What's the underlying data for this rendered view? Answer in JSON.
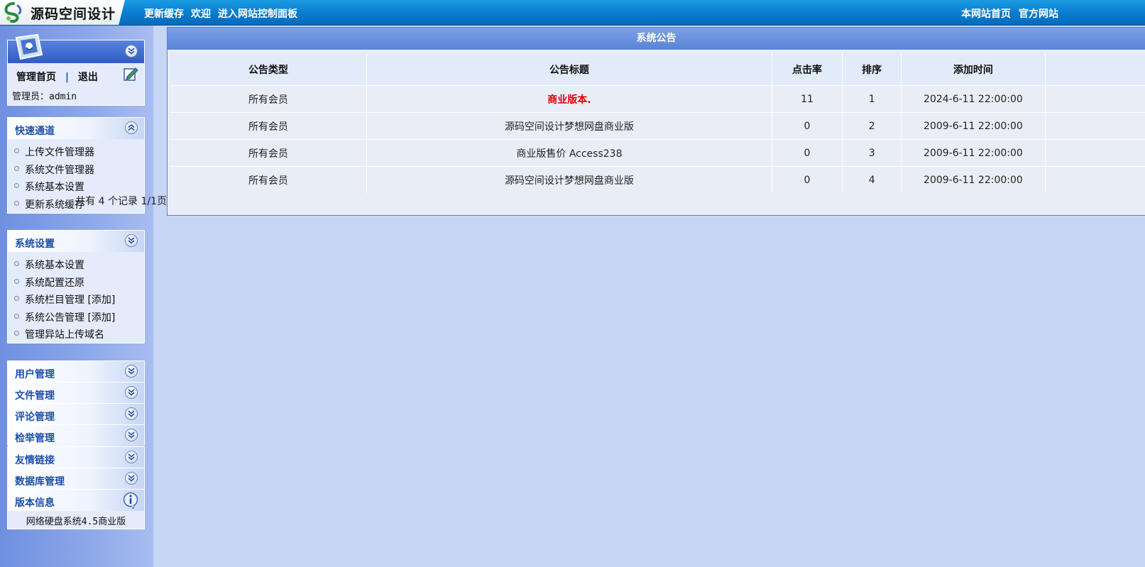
{
  "header": {
    "logo_text": "源码空间设计",
    "links": [
      "更新缓存",
      "欢迎",
      "进入网站控制面板"
    ],
    "right_links": [
      "本网站首页",
      "官方网站"
    ]
  },
  "sidebar": {
    "admin": {
      "home": "管理首页",
      "separator": "|",
      "logout": "退出",
      "user": "管理员：admin"
    },
    "quick": {
      "title": "快速通道",
      "items": [
        "上传文件管理器",
        "系统文件管理器",
        "系统基本设置",
        "更新系统缓存"
      ]
    },
    "settings": {
      "title": "系统设置",
      "items": [
        "系统基本设置",
        "系统配置还原",
        "系统栏目管理 [添加]",
        "系统公告管理 [添加]",
        "管理异站上传域名"
      ]
    },
    "collapsed": [
      "用户管理",
      "文件管理",
      "评论管理",
      "检举管理",
      "友情链接",
      "数据库管理"
    ],
    "version": {
      "title": "版本信息",
      "text": "网络硬盘系统4.5商业版"
    }
  },
  "main": {
    "title": "系统公告",
    "columns": [
      "公告类型",
      "公告标题",
      "点击率",
      "排序",
      "添加时间"
    ],
    "rows": [
      {
        "type": "所有会员",
        "title": "商业版本.",
        "clicks": "11",
        "order": "1",
        "time": "2024-6-11 22:00:00"
      },
      {
        "type": "所有会员",
        "title": "源码空间设计梦想网盘商业版",
        "clicks": "0",
        "order": "2",
        "time": "2009-6-11 22:00:00"
      },
      {
        "type": "所有会员",
        "title": "商业版售价 Access238",
        "clicks": "0",
        "order": "3",
        "time": "2009-6-11 22:00:00"
      },
      {
        "type": "所有会员",
        "title": "源码空间设计梦想网盘商业版",
        "clicks": "0",
        "order": "4",
        "time": "2009-6-11 22:00:00"
      }
    ],
    "pager": "共有 4 个记录 1/1页"
  },
  "colors": {
    "topbar": "#0a7ed0",
    "sidebar": "#8ea9ea",
    "background": "#c7d6f5",
    "highlight": "#e00000",
    "panel_title": "#1d4fa8"
  }
}
